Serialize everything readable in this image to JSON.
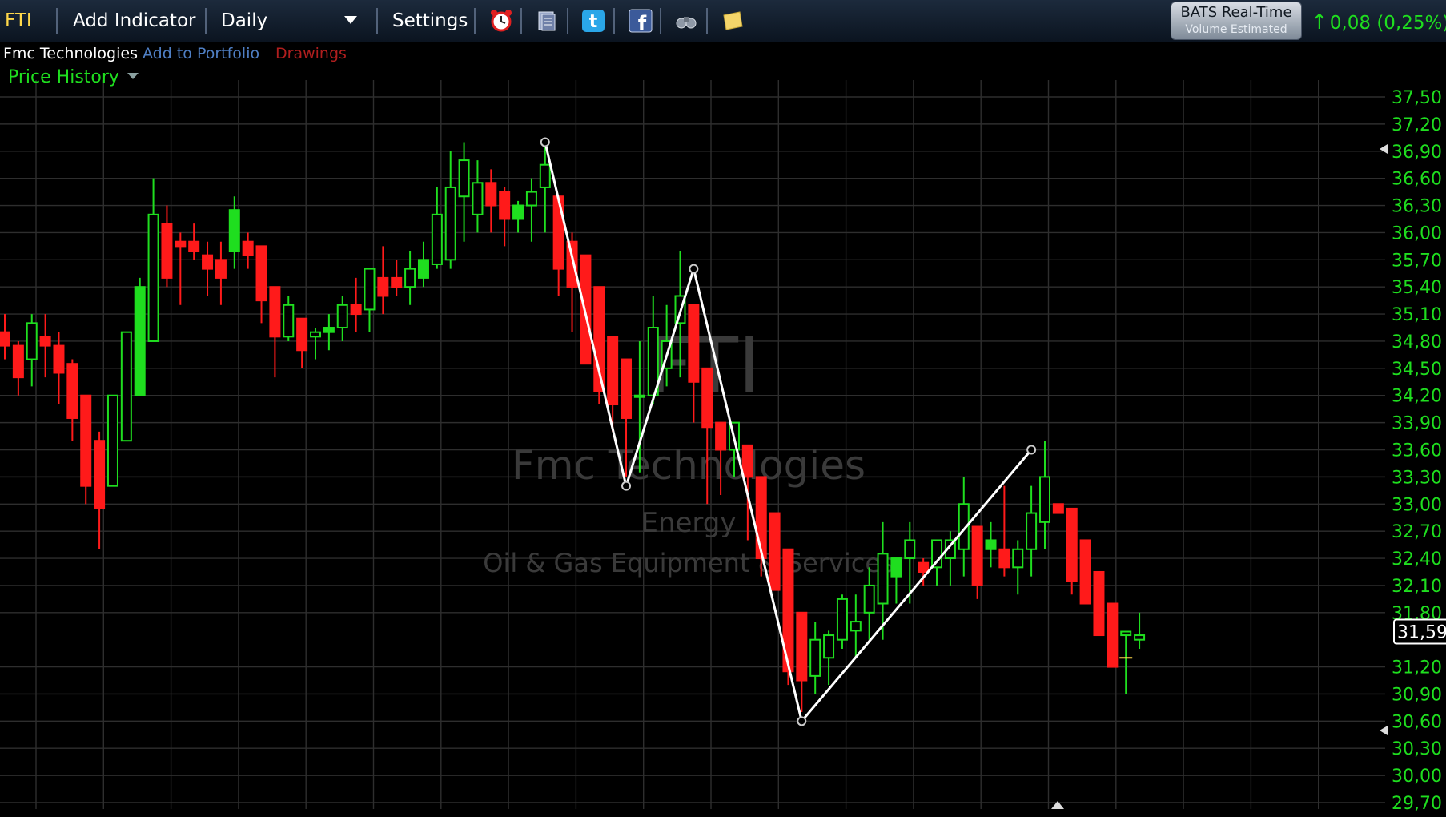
{
  "toolbar": {
    "ticker": "FTI",
    "add_indicator": "Add Indicator",
    "period": "Daily",
    "settings": "Settings",
    "icons": [
      "alarm-clock-icon",
      "stack-icon",
      "twitter-icon",
      "facebook-icon",
      "binoculars-icon",
      "note-icon"
    ]
  },
  "feed": {
    "line1": "BATS Real-Time",
    "line2": "Volume Estimated"
  },
  "change": {
    "text": "0,08 (0,25%)",
    "direction": "up",
    "color": "#1fde1f"
  },
  "subbar": {
    "company": "Fmc Technologies",
    "add_to_portfolio": "Add to Portfolio",
    "drawings": "Drawings"
  },
  "price_history_label": "Price History",
  "watermark": {
    "symbol": "FTI",
    "company": "Fmc Technologies",
    "sector": "Energy",
    "industry": "Oil & Gas Equipment & Services"
  },
  "colors": {
    "up": "#1fde1f",
    "down": "#ff1a1a",
    "axis_text": "#1fde1f",
    "ticker": "#ffd84a",
    "zigzag": "#ffffff"
  },
  "chart_data": {
    "type": "candlestick",
    "y_axis": {
      "min": 29.7,
      "max": 37.5,
      "ticks": [
        "37,50",
        "37,20",
        "36,90",
        "36,60",
        "36,30",
        "36,00",
        "35,70",
        "35,40",
        "35,10",
        "34,80",
        "34,50",
        "34,20",
        "33,90",
        "33,60",
        "33,30",
        "33,00",
        "32,70",
        "32,40",
        "32,10",
        "31,80",
        "31,20",
        "30,90",
        "30,60",
        "30,30",
        "30,00",
        "29,70"
      ],
      "last_price_label": "31,59",
      "last_price": 31.59
    },
    "grid": true,
    "candles": [
      [
        34.9,
        35.1,
        34.6,
        34.75
      ],
      [
        34.75,
        34.8,
        34.2,
        34.4
      ],
      [
        34.6,
        35.1,
        34.3,
        35.0
      ],
      [
        34.85,
        35.1,
        34.4,
        34.75
      ],
      [
        34.75,
        34.9,
        34.1,
        34.45
      ],
      [
        34.55,
        34.6,
        33.7,
        33.95
      ],
      [
        34.2,
        34.2,
        33.0,
        33.2
      ],
      [
        33.7,
        33.8,
        32.5,
        32.95
      ],
      [
        33.2,
        34.2,
        33.2,
        34.2
      ],
      [
        33.7,
        34.9,
        33.7,
        34.9
      ],
      [
        34.2,
        35.5,
        34.2,
        35.4
      ],
      [
        34.8,
        36.6,
        34.8,
        36.2
      ],
      [
        36.1,
        36.3,
        35.4,
        35.5
      ],
      [
        35.9,
        36.0,
        35.2,
        35.85
      ],
      [
        35.9,
        36.1,
        35.7,
        35.8
      ],
      [
        35.75,
        35.9,
        35.3,
        35.6
      ],
      [
        35.7,
        35.9,
        35.2,
        35.5
      ],
      [
        35.8,
        36.4,
        35.6,
        36.25
      ],
      [
        35.9,
        36.0,
        35.6,
        35.75
      ],
      [
        35.85,
        35.85,
        35.0,
        35.25
      ],
      [
        35.4,
        35.4,
        34.4,
        34.85
      ],
      [
        34.85,
        35.3,
        34.8,
        35.2
      ],
      [
        35.05,
        35.05,
        34.5,
        34.7
      ],
      [
        34.85,
        34.95,
        34.6,
        34.9
      ],
      [
        34.9,
        35.1,
        34.7,
        34.95
      ],
      [
        34.95,
        35.3,
        34.8,
        35.2
      ],
      [
        35.2,
        35.5,
        34.9,
        35.1
      ],
      [
        35.15,
        35.6,
        34.9,
        35.6
      ],
      [
        35.5,
        35.85,
        35.1,
        35.3
      ],
      [
        35.5,
        35.7,
        35.3,
        35.4
      ],
      [
        35.4,
        35.8,
        35.2,
        35.6
      ],
      [
        35.5,
        35.9,
        35.4,
        35.7
      ],
      [
        35.65,
        36.5,
        35.6,
        36.2
      ],
      [
        35.7,
        36.9,
        35.6,
        36.5
      ],
      [
        36.4,
        37.0,
        35.9,
        36.8
      ],
      [
        36.2,
        36.8,
        36.0,
        36.55
      ],
      [
        36.55,
        36.7,
        36.0,
        36.3
      ],
      [
        36.45,
        36.5,
        35.85,
        36.15
      ],
      [
        36.15,
        36.35,
        36.0,
        36.3
      ],
      [
        36.3,
        36.6,
        35.9,
        36.45
      ],
      [
        36.5,
        37.0,
        36.0,
        36.75
      ],
      [
        36.4,
        36.4,
        35.3,
        35.6
      ],
      [
        35.9,
        36.0,
        34.9,
        35.4
      ],
      [
        35.75,
        35.75,
        34.7,
        34.55
      ],
      [
        35.4,
        35.4,
        34.1,
        34.25
      ],
      [
        34.85,
        34.85,
        33.8,
        34.1
      ],
      [
        34.6,
        34.6,
        33.3,
        33.95
      ],
      [
        34.2,
        34.8,
        33.35,
        34.2
      ],
      [
        34.2,
        35.3,
        34.1,
        34.95
      ],
      [
        34.5,
        35.2,
        34.3,
        34.8
      ],
      [
        35.0,
        35.8,
        34.4,
        35.3
      ],
      [
        35.2,
        35.2,
        33.9,
        34.35
      ],
      [
        34.5,
        34.5,
        33.0,
        33.85
      ],
      [
        33.9,
        33.9,
        33.1,
        33.6
      ],
      [
        33.6,
        33.8,
        33.3,
        33.9
      ],
      [
        33.65,
        33.65,
        32.6,
        33.3
      ],
      [
        33.3,
        33.3,
        32.2,
        32.4
      ],
      [
        32.9,
        32.9,
        32.1,
        32.05
      ],
      [
        32.5,
        32.5,
        31.0,
        31.15
      ],
      [
        31.8,
        31.8,
        30.7,
        31.05
      ],
      [
        31.1,
        31.7,
        30.9,
        31.5
      ],
      [
        31.3,
        31.6,
        31.0,
        31.55
      ],
      [
        31.5,
        32.0,
        31.4,
        31.95
      ],
      [
        31.6,
        32.0,
        31.3,
        31.7
      ],
      [
        31.8,
        32.3,
        31.5,
        32.1
      ],
      [
        31.9,
        32.8,
        31.5,
        32.45
      ],
      [
        32.2,
        32.4,
        31.9,
        32.4
      ],
      [
        32.4,
        32.8,
        31.9,
        32.6
      ],
      [
        32.35,
        32.4,
        32.1,
        32.25
      ],
      [
        32.3,
        32.6,
        32.1,
        32.6
      ],
      [
        32.4,
        32.7,
        32.1,
        32.6
      ],
      [
        32.5,
        33.3,
        32.2,
        33.0
      ],
      [
        32.75,
        32.75,
        31.95,
        32.1
      ],
      [
        32.5,
        32.8,
        32.3,
        32.6
      ],
      [
        32.5,
        33.2,
        32.2,
        32.3
      ],
      [
        32.3,
        32.6,
        32.0,
        32.5
      ],
      [
        32.5,
        33.2,
        32.2,
        32.9
      ],
      [
        32.8,
        33.7,
        32.5,
        33.3
      ],
      [
        33.0,
        33.0,
        32.9,
        32.9
      ],
      [
        32.95,
        32.95,
        32.0,
        32.15
      ],
      [
        32.6,
        32.6,
        31.9,
        31.9
      ],
      [
        32.25,
        32.25,
        31.6,
        31.55
      ],
      [
        31.9,
        31.9,
        31.2,
        31.2
      ],
      [
        31.55,
        31.55,
        30.9,
        31.59
      ],
      [
        31.5,
        31.8,
        31.4,
        31.55
      ]
    ],
    "zigzag": [
      {
        "candle": 40,
        "price": 37.0
      },
      {
        "candle": 46,
        "price": 33.2
      },
      {
        "candle": 51,
        "price": 35.6
      },
      {
        "candle": 59,
        "price": 30.6
      },
      {
        "candle": 76,
        "price": 33.6
      }
    ]
  }
}
